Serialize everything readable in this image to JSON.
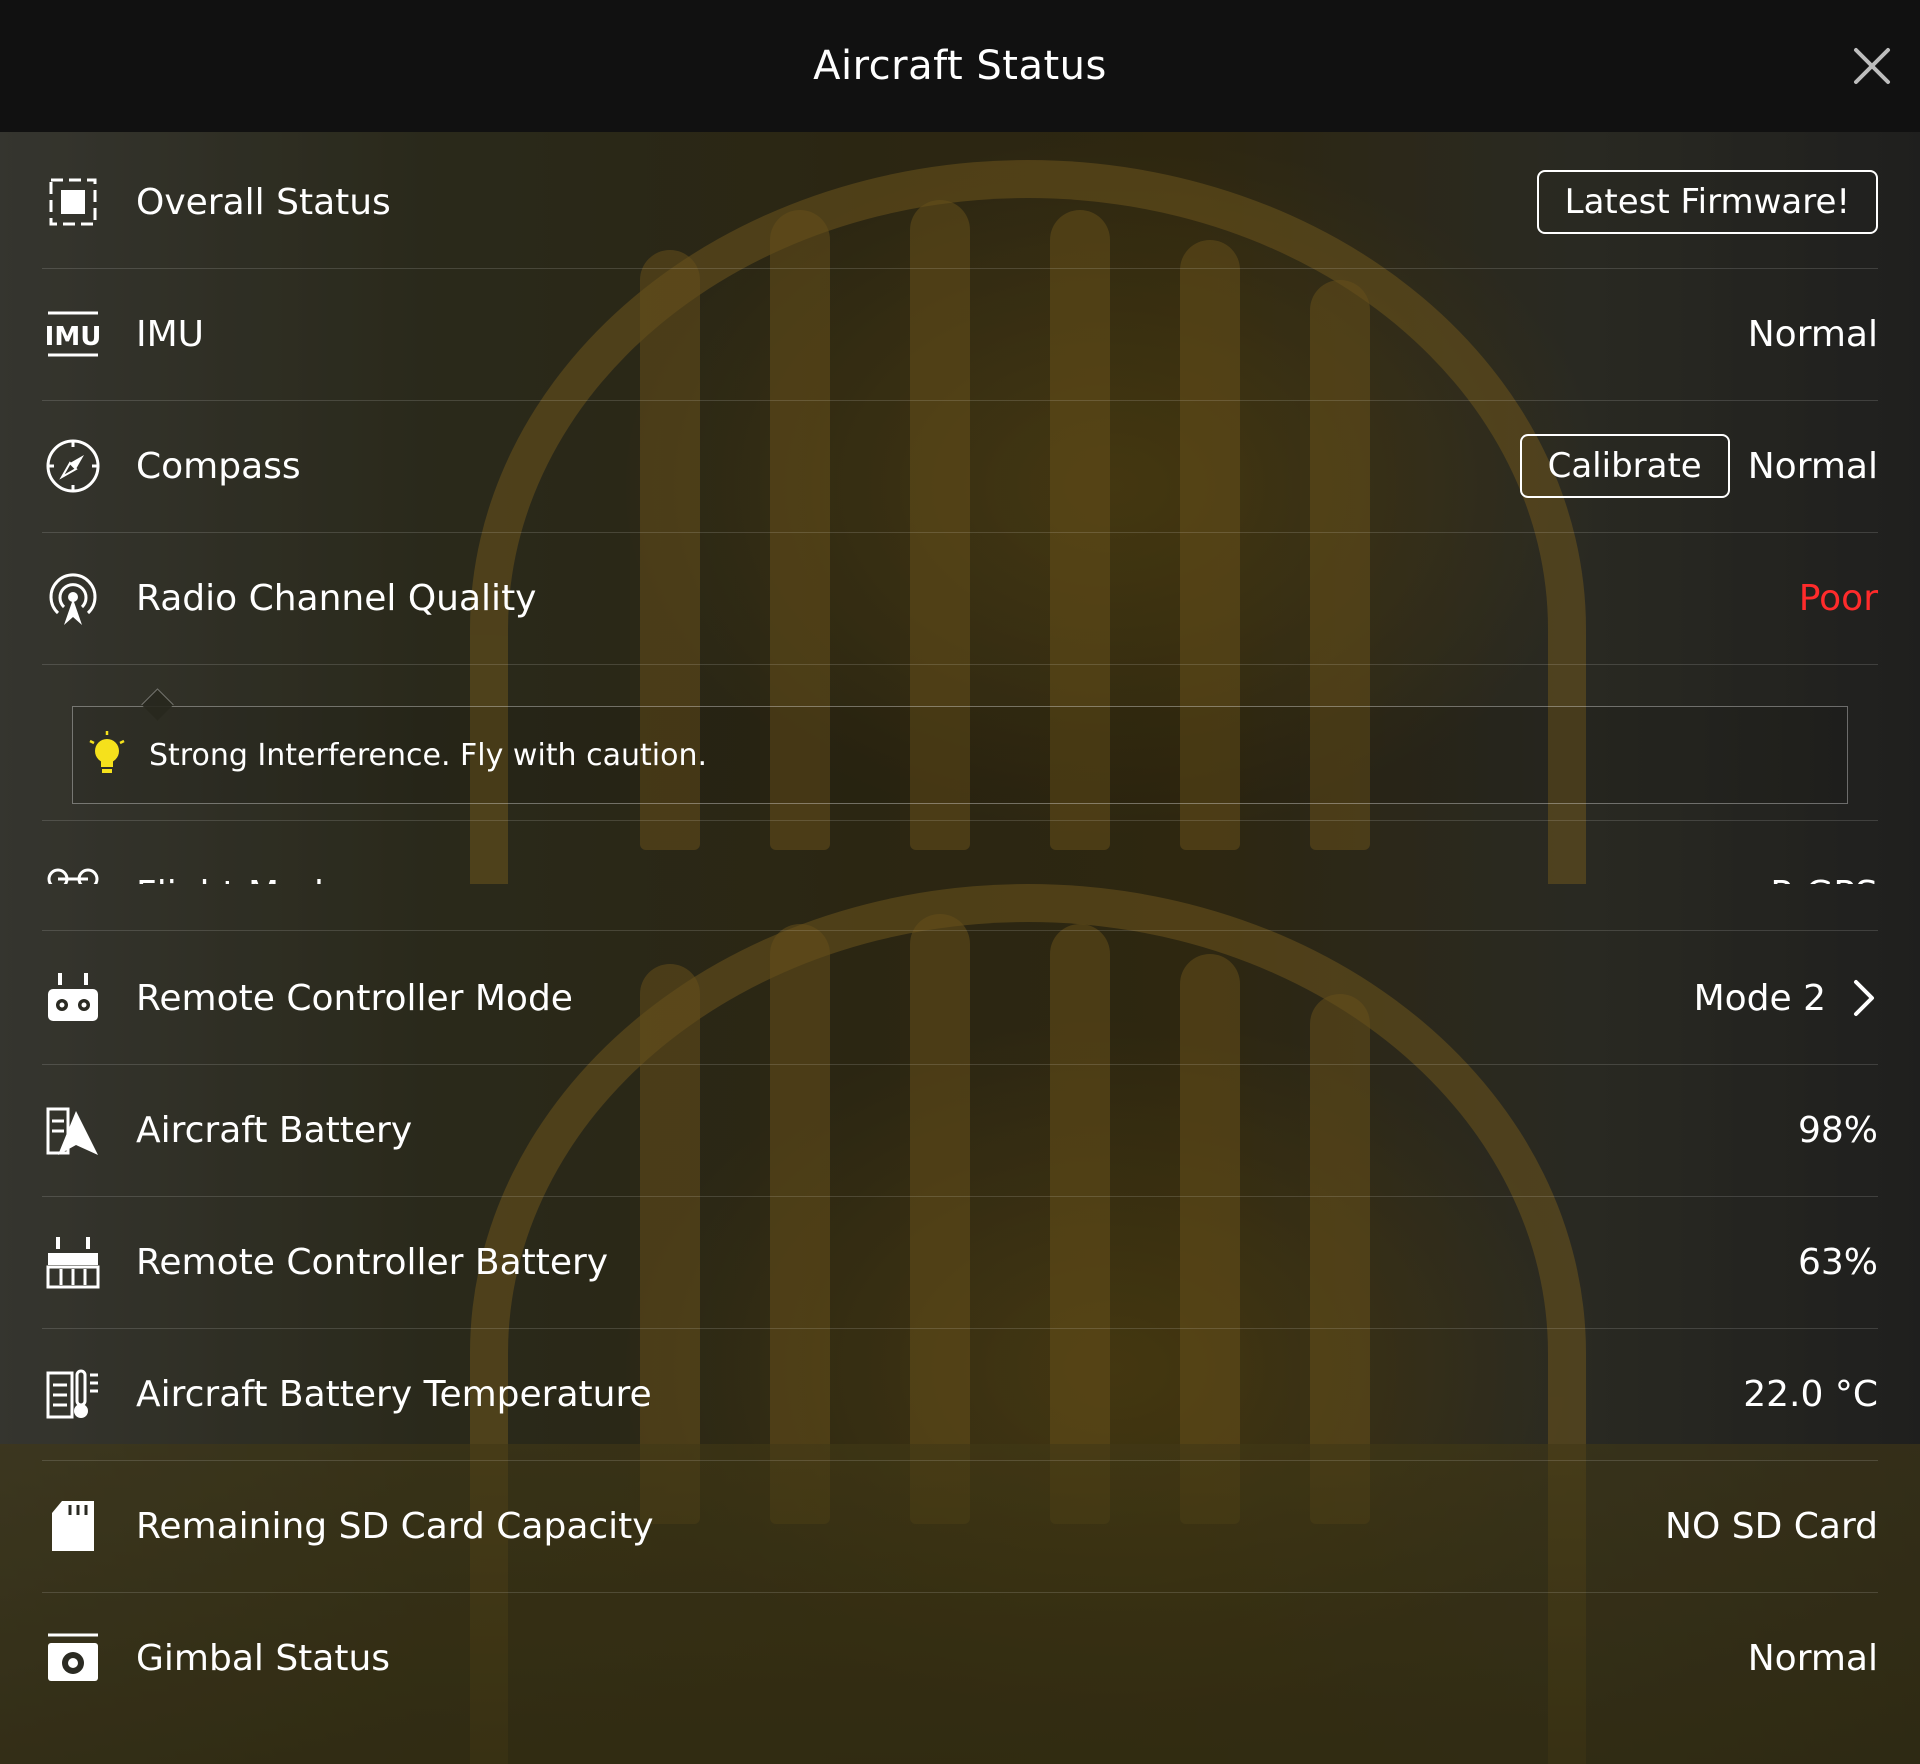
{
  "header": {
    "title": "Aircraft Status"
  },
  "rows": [
    {
      "name": "overall-status",
      "icon": "overall-status-icon",
      "label": "Overall Status",
      "button": "Latest Firmware!"
    },
    {
      "name": "imu",
      "icon": "imu-icon",
      "label": "IMU",
      "value": "Normal"
    },
    {
      "name": "compass",
      "icon": "compass-icon",
      "label": "Compass",
      "button": "Calibrate",
      "value": "Normal"
    },
    {
      "name": "radio-channel-quality",
      "icon": "radio-signal-icon",
      "label": "Radio Channel Quality",
      "value": "Poor"
    },
    {
      "name": "flight-mode",
      "icon": "flight-mode-icon",
      "label": "Flight Mode",
      "value": "P-GPS"
    },
    {
      "name": "remote-controller-mode",
      "icon": "remote-controller-icon",
      "label": "Remote Controller Mode",
      "value": "Mode 2"
    },
    {
      "name": "aircraft-battery",
      "icon": "aircraft-battery-icon",
      "label": "Aircraft Battery",
      "value": "98%"
    },
    {
      "name": "remote-controller-battery",
      "icon": "remote-controller-battery-icon",
      "label": "Remote Controller Battery",
      "value": "63%"
    },
    {
      "name": "aircraft-battery-temperature",
      "icon": "battery-temperature-icon",
      "label": "Aircraft Battery Temperature",
      "value": "22.0 °C"
    },
    {
      "name": "remaining-sd-card-capacity",
      "icon": "sd-card-icon",
      "label": "Remaining SD Card Capacity",
      "value": "NO SD Card"
    },
    {
      "name": "gimbal-status",
      "icon": "gimbal-camera-icon",
      "label": "Gimbal Status",
      "value": "Normal"
    }
  ],
  "tip": {
    "icon": "lightbulb-icon",
    "text": "Strong Interference. Fly with caution."
  },
  "colors": {
    "header_bg": "#111111",
    "text": "#ffffff",
    "poor": "#ff2b2b",
    "bulb": "#f5e11c"
  }
}
